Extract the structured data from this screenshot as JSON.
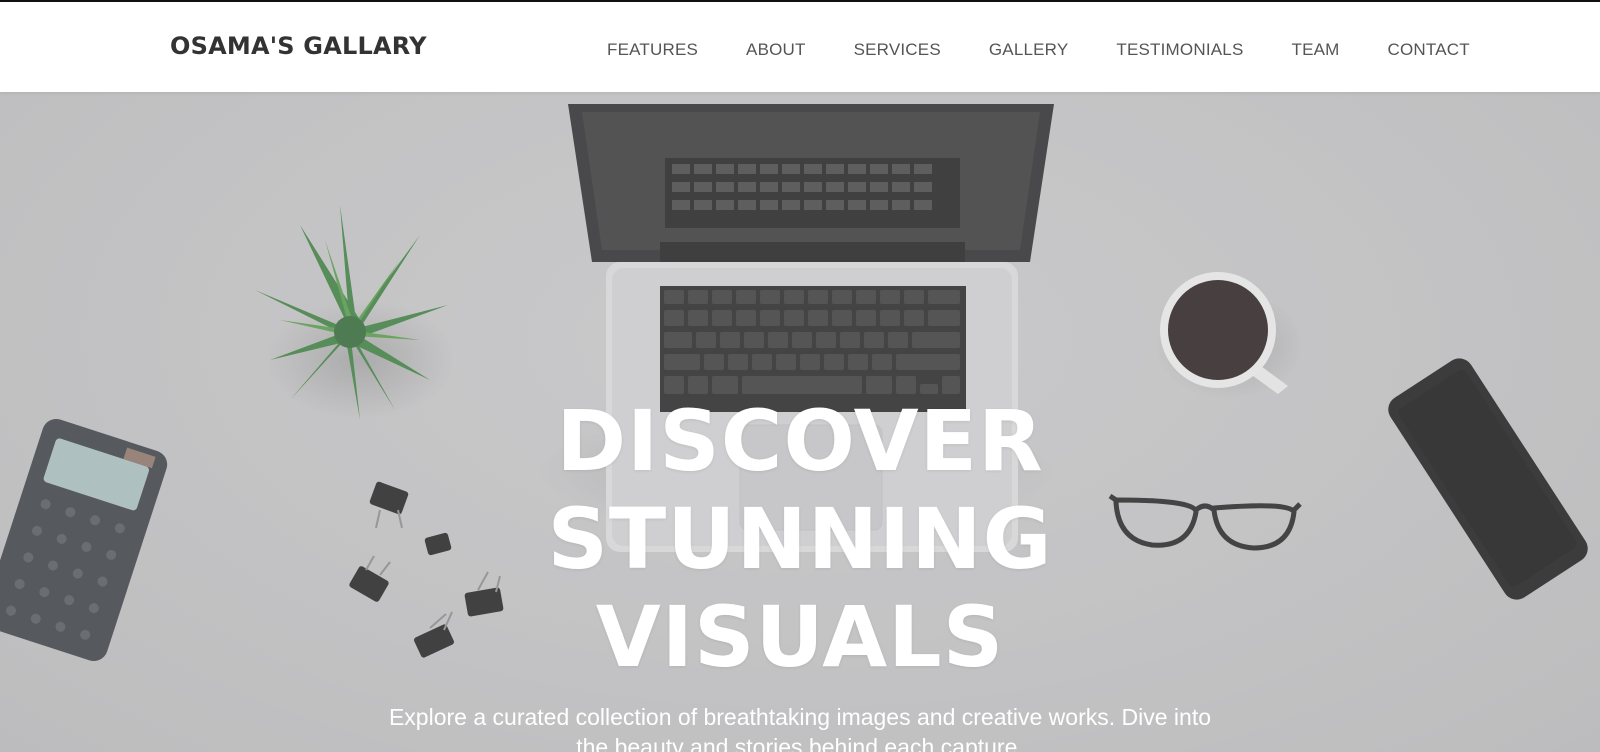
{
  "header": {
    "brand": "OSAMA'S GALLARY",
    "nav": [
      {
        "label": "FEATURES"
      },
      {
        "label": "ABOUT"
      },
      {
        "label": "SERVICES"
      },
      {
        "label": "GALLERY"
      },
      {
        "label": "TESTIMONIALS"
      },
      {
        "label": "TEAM"
      },
      {
        "label": "CONTACT"
      }
    ]
  },
  "hero": {
    "title_lines": [
      "DISCOVER",
      "STUNNING",
      "VISUALS"
    ],
    "subtitle": "Explore a curated collection of breathtaking images and creative works. Dive into the beauty and stories behind each capture."
  },
  "colors": {
    "header_bg": "#ffffff",
    "hero_bg": "#c9c9cb",
    "hero_text": "#ffffff",
    "nav_text": "#555555",
    "brand_text": "#333333"
  },
  "icons": [
    "laptop-image",
    "plant-image",
    "calculator-image",
    "coffee-cup-image",
    "glasses-image",
    "phone-image",
    "binder-clips-image"
  ]
}
